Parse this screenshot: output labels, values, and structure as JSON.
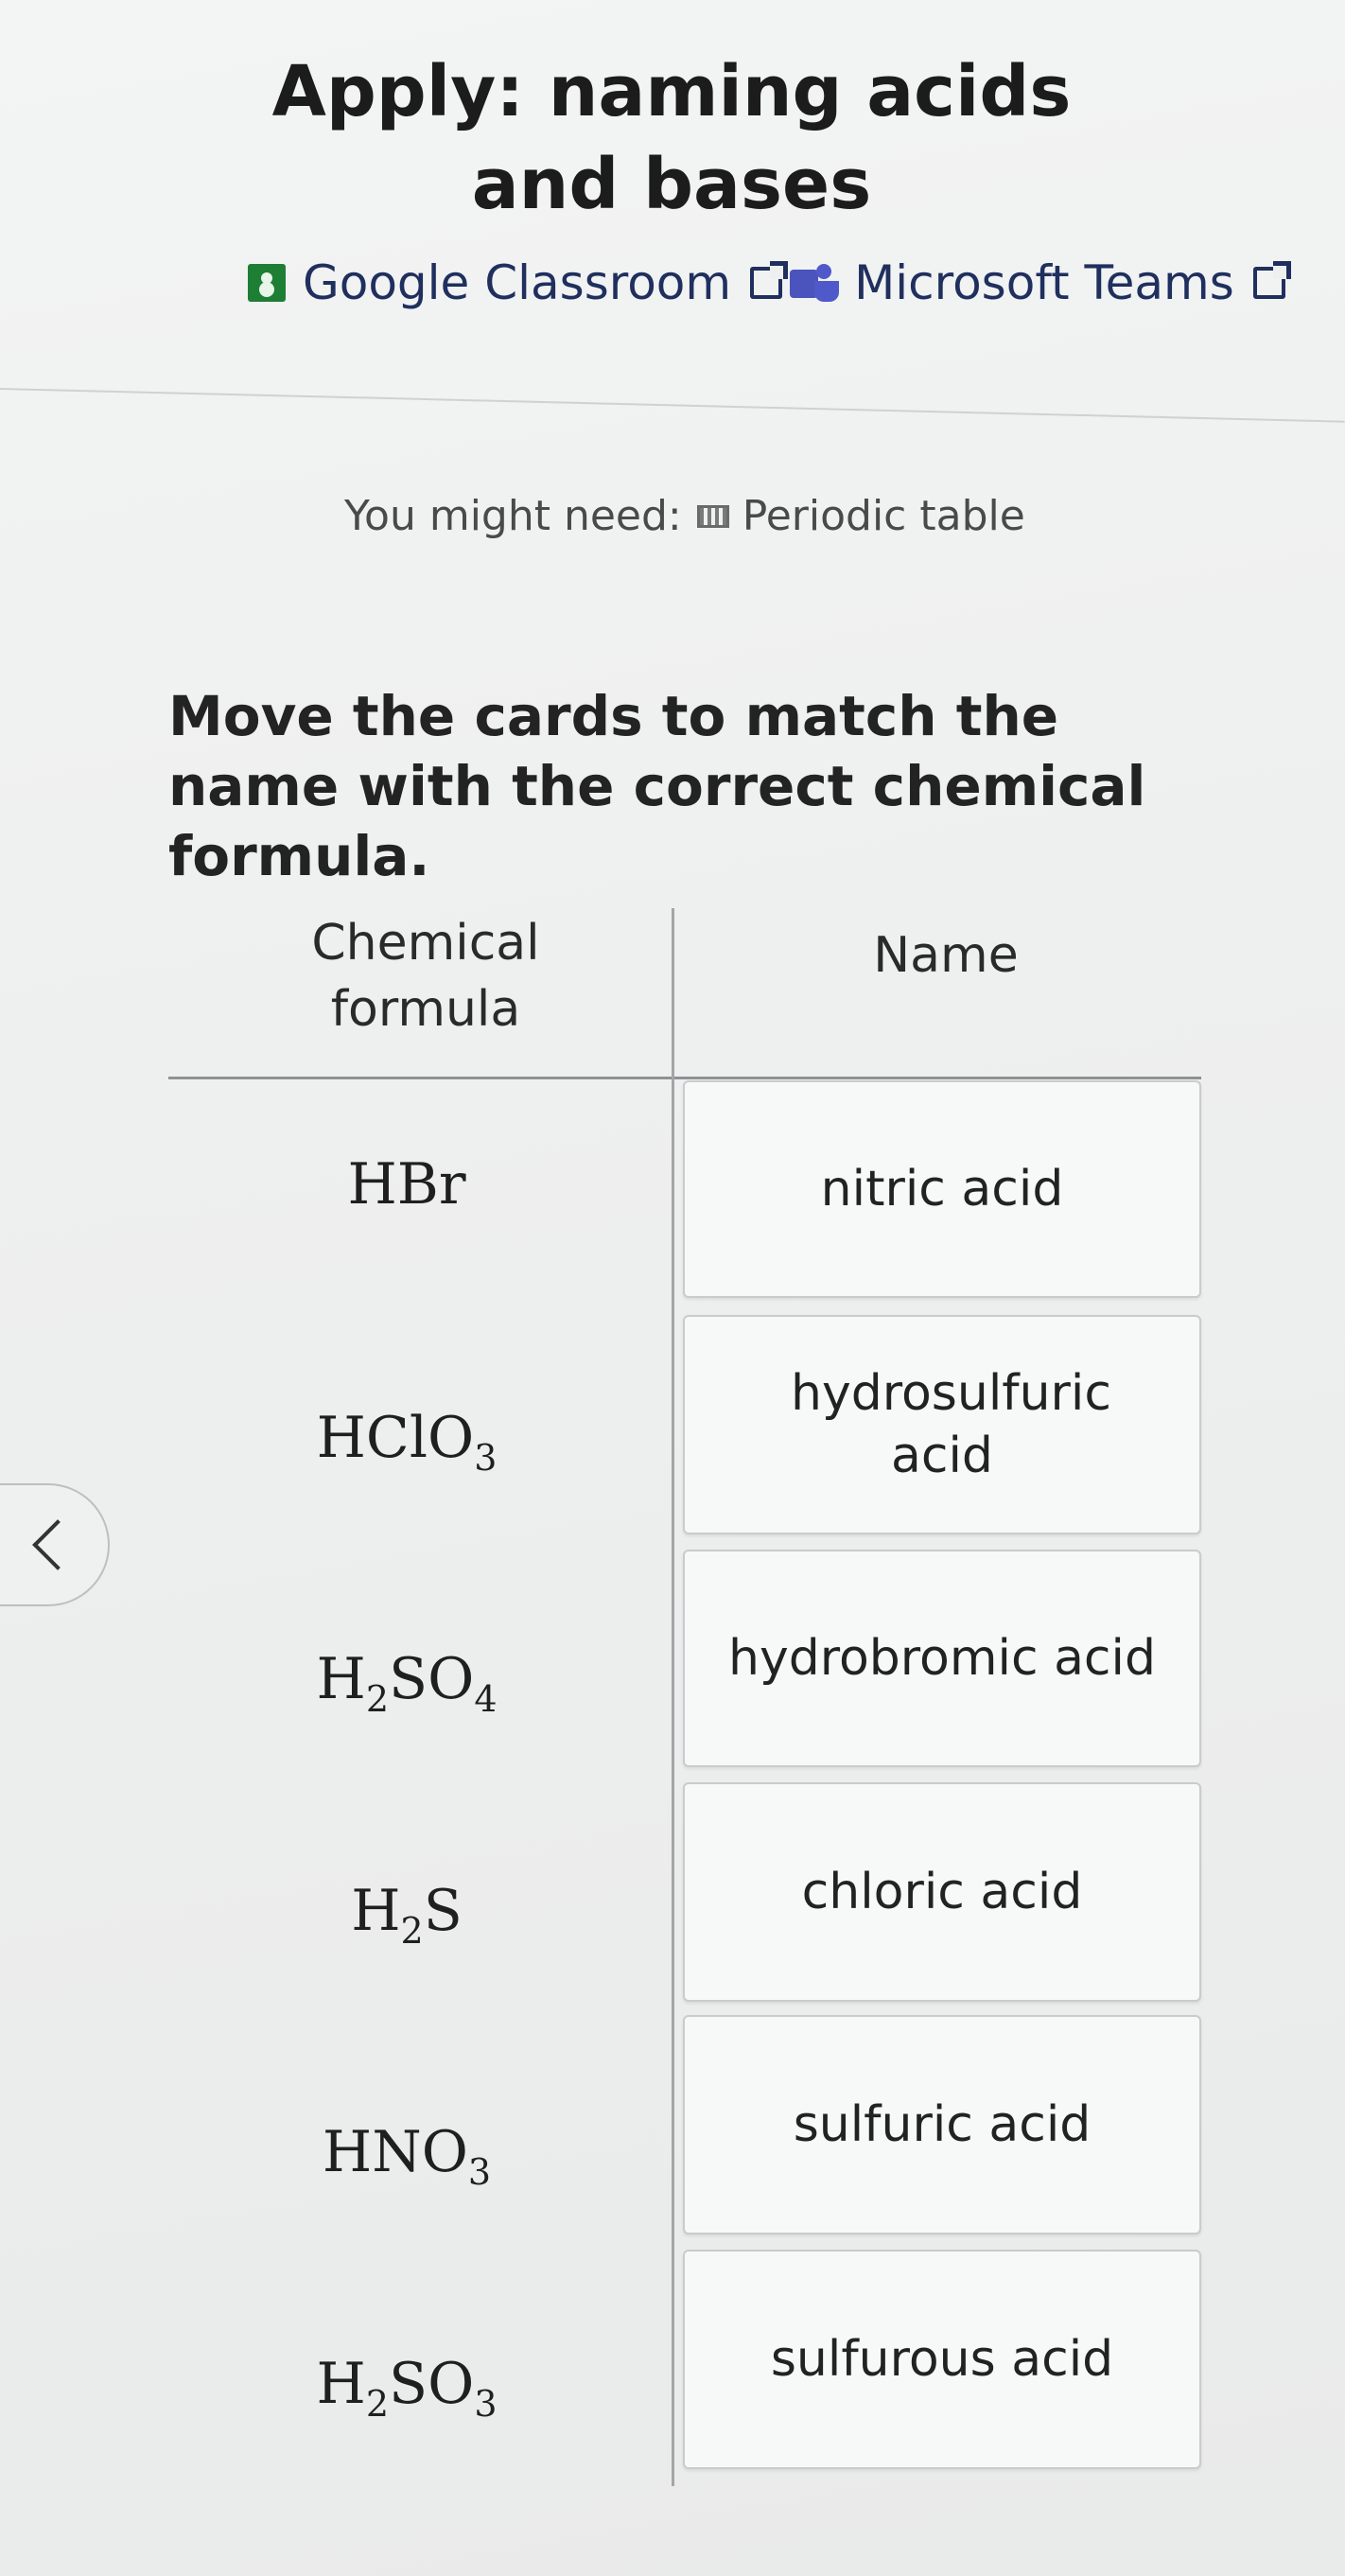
{
  "page": {
    "title": "Apply: naming acids and bases"
  },
  "share": {
    "google_classroom": "Google Classroom",
    "microsoft_teams": "Microsoft Teams"
  },
  "resources": {
    "prefix": "You might need:",
    "periodic_table": "Periodic table"
  },
  "prompt": "Move the cards to match the name with the correct chemical formula.",
  "table": {
    "header_formula": "Chemical formula",
    "header_name": "Name",
    "formulas": [
      {
        "parts": [
          "HBr"
        ]
      },
      {
        "parts": [
          "HClO",
          "3"
        ]
      },
      {
        "parts": [
          "H",
          "2",
          "SO",
          "4"
        ]
      },
      {
        "parts": [
          "H",
          "2",
          "S"
        ]
      },
      {
        "parts": [
          "HNO",
          "3"
        ]
      },
      {
        "parts": [
          "H",
          "2",
          "SO",
          "3"
        ]
      }
    ],
    "names": [
      "nitric acid",
      "hydrosulfuric acid",
      "hydrobromic acid",
      "chloric acid",
      "sulfuric acid",
      "sulfurous acid"
    ]
  },
  "colors": {
    "link": "#1f2f5e",
    "background": "#eeefef",
    "card": "#f7f8f8"
  },
  "icons": [
    "google-classroom-icon",
    "external-link-icon",
    "microsoft-teams-icon",
    "periodic-table-icon",
    "chevron-left-icon"
  ]
}
